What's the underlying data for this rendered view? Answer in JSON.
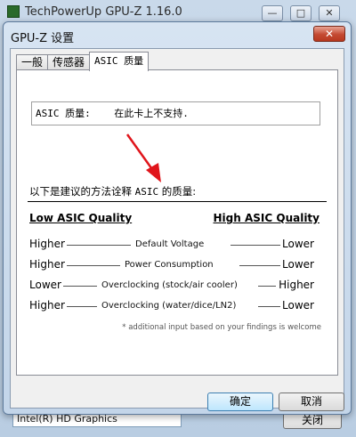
{
  "background_window": {
    "title": "TechPowerUp GPU-Z 1.16.0",
    "controls": [
      "—",
      "□",
      "✕"
    ],
    "bottom_field_value": "Intel(R) HD Graphics",
    "bottom_button_label": "关闭"
  },
  "dialog": {
    "title": "GPU-Z 设置",
    "close_symbol": "✕",
    "tabs": [
      {
        "label": "一般",
        "active": false
      },
      {
        "label": "传感器",
        "active": false
      },
      {
        "label": "ASIC 质量",
        "active": true
      }
    ],
    "asic_message": "ASIC 质量:    在此卡上不支持.",
    "intro_prefix": "以下是建议的方法诠释 ",
    "intro_mono": "ASIC",
    "intro_suffix": " 的质量:",
    "low_heading": "Low ASIC Quality",
    "high_heading": "High ASIC Quality",
    "rows": [
      {
        "left": "Higher",
        "middle": "Default Voltage",
        "right": "Lower"
      },
      {
        "left": "Higher",
        "middle": "Power Consumption",
        "right": "Lower"
      },
      {
        "left": "Lower",
        "middle": "Overclocking (stock/air cooler)",
        "right": "Higher"
      },
      {
        "left": "Higher",
        "middle": "Overclocking (water/dice/LN2)",
        "right": "Lower"
      }
    ],
    "footnote": "* additional input based on your findings is welcome",
    "ok_label": "确定",
    "cancel_label": "取消"
  },
  "colors": {
    "arrow": "#e0151b",
    "close_button": "#c44a32",
    "ok_border": "#3c7fb1"
  }
}
